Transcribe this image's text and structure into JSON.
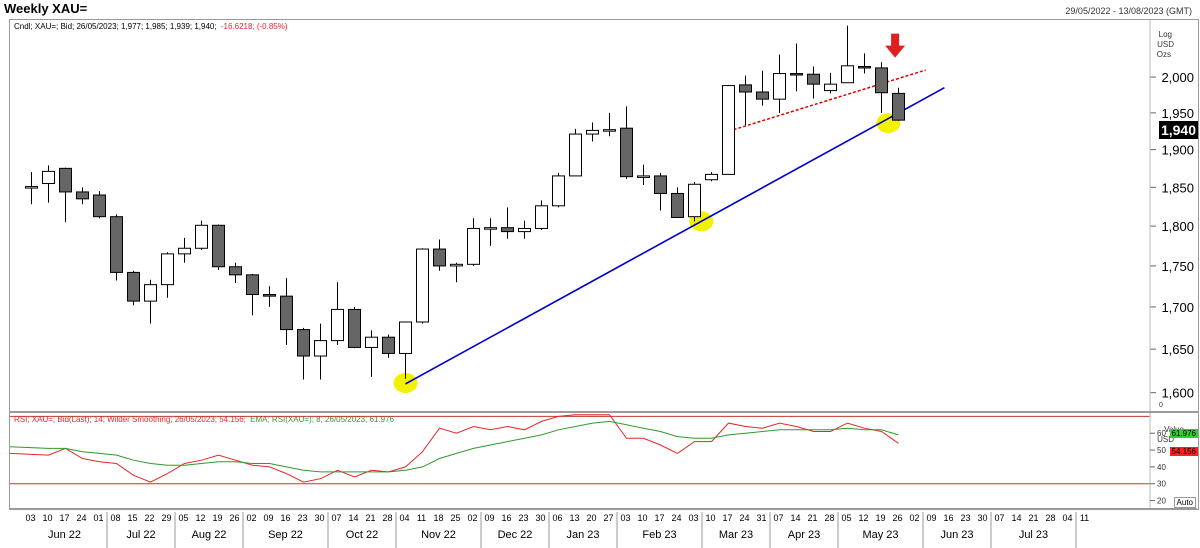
{
  "header": {
    "title": "Weekly XAU=",
    "date_range": "29/05/2022 - 13/08/2023 (GMT)"
  },
  "price_panel": {
    "legend": {
      "label": "Cndl; XAU=; Bid; 26/05/2023; 1,977; 1,985; 1,939; 1,940;",
      "change": "-16.6218; (-0.85%)"
    },
    "scale_labels": [
      "Log",
      "USD",
      "Ozs"
    ],
    "last_price": "1,940",
    "y_tick_labels": [
      "2,000",
      "1,950",
      "1,900",
      "1,850",
      "1,800",
      "1,750",
      "1,700",
      "1,650",
      "1,600"
    ],
    "corner_mark": "0"
  },
  "rsi_panel": {
    "legend_rsi": "RSI; XAU=; Bid(Last); 14; Wilder Smoothing; 26/05/2023; 54.156;",
    "legend_ema": "EMA; RSI(XAU=); 8; 26/05/2023; 61.976",
    "side_labels": [
      "Value",
      "USD"
    ],
    "ema_last": "61.976",
    "rsi_last": "54.156",
    "y_tick_labels": [
      "60",
      "50",
      "40",
      "30",
      "20"
    ],
    "auto_label": "Auto",
    "colors": {
      "rsi": "#e8262a",
      "ema": "#2e9a2e",
      "ema_tag": "#33cc33",
      "rsi_tag": "#ff2020",
      "bands": "#c0392b"
    }
  },
  "x_axis": {
    "day_labels": [
      "03",
      "10",
      "17",
      "24",
      "01",
      "08",
      "15",
      "22",
      "29",
      "05",
      "12",
      "19",
      "26",
      "02",
      "09",
      "16",
      "23",
      "30",
      "07",
      "14",
      "21",
      "28",
      "04",
      "11",
      "18",
      "25",
      "02",
      "09",
      "16",
      "23",
      "30",
      "06",
      "13",
      "20",
      "27",
      "03",
      "10",
      "17",
      "24",
      "03",
      "10",
      "17",
      "24",
      "31",
      "07",
      "14",
      "21",
      "28",
      "05",
      "12",
      "19",
      "26",
      "02",
      "09",
      "16",
      "23",
      "30",
      "07",
      "14",
      "21",
      "28",
      "04",
      "11"
    ],
    "month_labels": [
      "Jun 22",
      "Jul 22",
      "Aug 22",
      "Sep 22",
      "Oct 22",
      "Nov 22",
      "Dec 22",
      "Jan 23",
      "Feb 23",
      "Mar 23",
      "Apr 23",
      "May 23",
      "Jun 23",
      "Jul 23"
    ]
  },
  "chart_data": [
    {
      "type": "candlestick",
      "title": "Weekly XAU=",
      "ylabel": "USD",
      "y_scale": "log",
      "ylim": [
        1585,
        2075
      ],
      "candles": [
        {
          "o": 1851,
          "h": 1870,
          "l": 1828,
          "c": 1851
        },
        {
          "o": 1855,
          "h": 1879,
          "l": 1830,
          "c": 1871
        },
        {
          "o": 1875,
          "h": 1876,
          "l": 1805,
          "c": 1844
        },
        {
          "o": 1844,
          "h": 1850,
          "l": 1828,
          "c": 1835
        },
        {
          "o": 1840,
          "h": 1845,
          "l": 1810,
          "c": 1812
        },
        {
          "o": 1812,
          "h": 1815,
          "l": 1732,
          "c": 1742
        },
        {
          "o": 1742,
          "h": 1744,
          "l": 1702,
          "c": 1707
        },
        {
          "o": 1707,
          "h": 1733,
          "l": 1680,
          "c": 1727
        },
        {
          "o": 1727,
          "h": 1767,
          "l": 1711,
          "c": 1765
        },
        {
          "o": 1765,
          "h": 1785,
          "l": 1754,
          "c": 1772
        },
        {
          "o": 1772,
          "h": 1807,
          "l": 1770,
          "c": 1801
        },
        {
          "o": 1801,
          "h": 1802,
          "l": 1745,
          "c": 1749
        },
        {
          "o": 1749,
          "h": 1754,
          "l": 1729,
          "c": 1739
        },
        {
          "o": 1739,
          "h": 1740,
          "l": 1690,
          "c": 1715
        },
        {
          "o": 1715,
          "h": 1725,
          "l": 1700,
          "c": 1713
        },
        {
          "o": 1713,
          "h": 1735,
          "l": 1655,
          "c": 1673
        },
        {
          "o": 1673,
          "h": 1675,
          "l": 1615,
          "c": 1642
        },
        {
          "o": 1642,
          "h": 1680,
          "l": 1615,
          "c": 1660
        },
        {
          "o": 1660,
          "h": 1730,
          "l": 1655,
          "c": 1697
        },
        {
          "o": 1697,
          "h": 1700,
          "l": 1651,
          "c": 1652
        },
        {
          "o": 1652,
          "h": 1672,
          "l": 1618,
          "c": 1664
        },
        {
          "o": 1664,
          "h": 1667,
          "l": 1640,
          "c": 1645
        },
        {
          "o": 1645,
          "h": 1682,
          "l": 1616,
          "c": 1682
        },
        {
          "o": 1682,
          "h": 1772,
          "l": 1680,
          "c": 1771
        },
        {
          "o": 1771,
          "h": 1783,
          "l": 1744,
          "c": 1750
        },
        {
          "o": 1750,
          "h": 1754,
          "l": 1730,
          "c": 1752
        },
        {
          "o": 1752,
          "h": 1810,
          "l": 1750,
          "c": 1797
        },
        {
          "o": 1797,
          "h": 1810,
          "l": 1775,
          "c": 1798
        },
        {
          "o": 1798,
          "h": 1824,
          "l": 1784,
          "c": 1793
        },
        {
          "o": 1793,
          "h": 1807,
          "l": 1784,
          "c": 1797
        },
        {
          "o": 1797,
          "h": 1833,
          "l": 1795,
          "c": 1826
        },
        {
          "o": 1826,
          "h": 1869,
          "l": 1824,
          "c": 1865
        },
        {
          "o": 1865,
          "h": 1928,
          "l": 1865,
          "c": 1921
        },
        {
          "o": 1921,
          "h": 1937,
          "l": 1911,
          "c": 1926
        },
        {
          "o": 1926,
          "h": 1950,
          "l": 1918,
          "c": 1927
        },
        {
          "o": 1929,
          "h": 1959,
          "l": 1861,
          "c": 1864
        },
        {
          "o": 1864,
          "h": 1880,
          "l": 1853,
          "c": 1865
        },
        {
          "o": 1865,
          "h": 1869,
          "l": 1820,
          "c": 1842
        },
        {
          "o": 1842,
          "h": 1850,
          "l": 1811,
          "c": 1811
        },
        {
          "o": 1812,
          "h": 1857,
          "l": 1806,
          "c": 1854
        },
        {
          "o": 1860,
          "h": 1870,
          "l": 1858,
          "c": 1867
        },
        {
          "o": 1867,
          "h": 1989,
          "l": 1868,
          "c": 1988
        },
        {
          "o": 1989,
          "h": 2002,
          "l": 1933,
          "c": 1979
        },
        {
          "o": 1979,
          "h": 2009,
          "l": 1960,
          "c": 1969
        },
        {
          "o": 1969,
          "h": 2032,
          "l": 1950,
          "c": 2005
        },
        {
          "o": 2005,
          "h": 2048,
          "l": 1980,
          "c": 2004
        },
        {
          "o": 2004,
          "h": 2015,
          "l": 1970,
          "c": 1990
        },
        {
          "o": 1981,
          "h": 2006,
          "l": 1977,
          "c": 1990
        },
        {
          "o": 1992,
          "h": 2074,
          "l": 1995,
          "c": 2016
        },
        {
          "o": 2015,
          "h": 2034,
          "l": 2005,
          "c": 2013
        },
        {
          "o": 2013,
          "h": 2021,
          "l": 1950,
          "c": 1978
        },
        {
          "o": 1977,
          "h": 1985,
          "l": 1939,
          "c": 1940
        }
      ]
    },
    {
      "type": "line",
      "title": "RSI; XAU=; Bid(Last); 14; Wilder Smoothing",
      "ylim": [
        15,
        72
      ],
      "bands": [
        70,
        30
      ],
      "series": [
        {
          "name": "RSI",
          "values": [
            48,
            47,
            51,
            45,
            43,
            42,
            35,
            31,
            36,
            42,
            44,
            47,
            44,
            41,
            40,
            36,
            31,
            33,
            38,
            34,
            38,
            37,
            40,
            49,
            63,
            60,
            64,
            62,
            64,
            62,
            67,
            70,
            71,
            71,
            71,
            57,
            57,
            53,
            48,
            55,
            55,
            66,
            64,
            63,
            66,
            64,
            61,
            61,
            66,
            63,
            61,
            54
          ]
        },
        {
          "name": "EMA",
          "values": [
            52,
            51,
            51,
            49,
            48,
            47,
            44,
            42,
            41,
            41,
            42,
            43,
            43,
            42,
            42,
            40,
            38,
            37,
            37,
            37,
            37,
            37,
            38,
            40,
            45,
            48,
            51,
            53,
            55,
            57,
            59,
            62,
            64,
            66,
            67,
            65,
            63,
            61,
            58,
            57,
            57,
            59,
            60,
            61,
            62,
            62,
            62,
            62,
            63,
            62,
            62,
            59
          ]
        }
      ]
    }
  ],
  "overlays": {
    "support_line": {
      "from": {
        "week": 22,
        "price": 1610
      },
      "to": {
        "week": 53.7,
        "price": 1985
      },
      "color": "#0000cc"
    },
    "resistance_line": {
      "from": {
        "week": 41.3,
        "price": 1927
      },
      "to": {
        "week": 52.6,
        "price": 2010
      },
      "color": "#e00000"
    },
    "highlights": [
      {
        "week": 22,
        "price": 1611
      },
      {
        "week": 39.4,
        "price": 1806
      },
      {
        "week": 50.4,
        "price": 1936
      }
    ],
    "highlight_color": "#f2f200",
    "arrow": {
      "week": 50.8,
      "price": 2042,
      "color": "#e02020"
    }
  }
}
